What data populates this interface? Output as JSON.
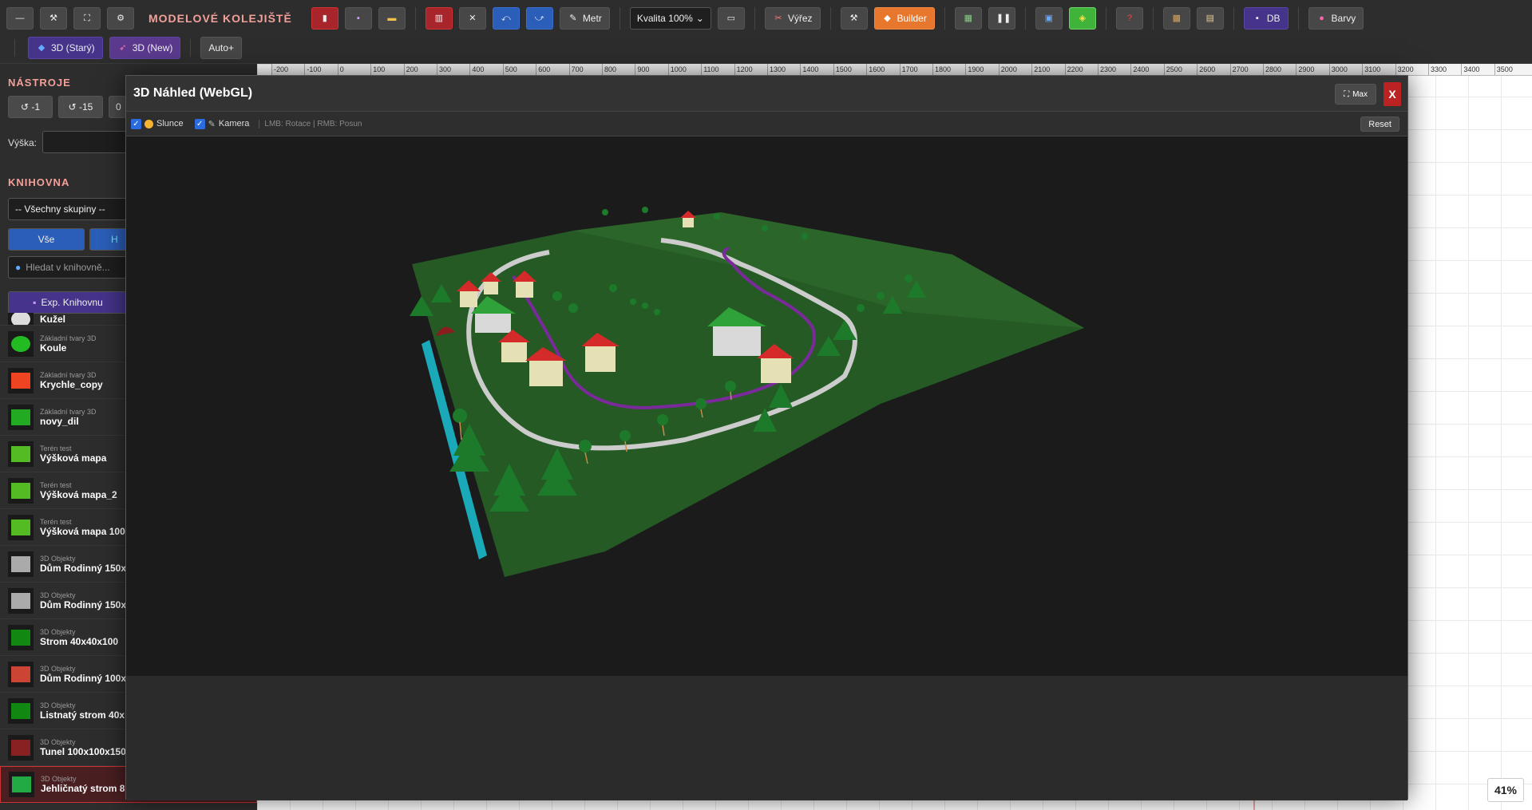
{
  "toolbar": {
    "app_title": "MODELOVÉ KOLEJIŠTĚ",
    "measure_label": "Metr",
    "quality_value": "Kvalita 100%",
    "crop_label": "Výřez",
    "builder_label": "Builder",
    "db_label": "DB",
    "colors_label": "Barvy",
    "view3d_old_label": "3D (Starý)",
    "view3d_new_label": "3D (New)",
    "auto_label": "Auto+"
  },
  "left": {
    "tools_title": "NÁSTROJE",
    "rot_minus1": "↺ -1",
    "rot_minus15": "↺ -15",
    "rot_zero": "0",
    "height_label": "Výška:",
    "library_title": "KNIHOVNA",
    "group_select": "-- Všechny skupiny --",
    "filter_all": "Vše",
    "filter_second": "H",
    "search_placeholder": "Hledat v knihovně...",
    "export_label": "Exp. Knihovnu",
    "items": [
      {
        "cat": "",
        "name": "Kužel",
        "color": "#dddddd"
      },
      {
        "cat": "Základní tvary 3D",
        "name": "Koule",
        "color": "#22bb22"
      },
      {
        "cat": "Základní tvary 3D",
        "name": "Krychle_copy",
        "color": "#ee4422"
      },
      {
        "cat": "Základní tvary 3D",
        "name": "novy_dil",
        "color": "#22aa22"
      },
      {
        "cat": "Terén test",
        "name": "Výšková mapa",
        "color": "#55bb22"
      },
      {
        "cat": "Terén test",
        "name": "Výšková mapa_2",
        "color": "#55bb22"
      },
      {
        "cat": "Terén test",
        "name": "Výšková mapa 100",
        "color": "#55bb22"
      },
      {
        "cat": "3D Objekty",
        "name": "Dům Rodinný 150x",
        "color": "#aaaaaa"
      },
      {
        "cat": "3D Objekty",
        "name": "Dům Rodinný 150x",
        "color": "#aaaaaa"
      },
      {
        "cat": "3D Objekty",
        "name": "Strom 40x40x100",
        "color": "#118811"
      },
      {
        "cat": "3D Objekty",
        "name": "Dům Rodinný 100x",
        "color": "#cc4433"
      },
      {
        "cat": "3D Objekty",
        "name": "Listnatý strom 40x",
        "color": "#118811"
      },
      {
        "cat": "3D Objekty",
        "name": "Tunel 100x100x150",
        "color": "#882222"
      },
      {
        "cat": "3D Objekty",
        "name": "Jehličnatý strom 8",
        "color": "#22aa44"
      }
    ]
  },
  "ruler": [
    "-200",
    "-100",
    "0",
    "100",
    "200",
    "300",
    "400",
    "500",
    "600",
    "700",
    "800",
    "900",
    "1000",
    "1100",
    "1200",
    "1300",
    "1400",
    "1500",
    "1600",
    "1700",
    "1800",
    "1900",
    "2000",
    "2100",
    "2200",
    "2300",
    "2400",
    "2500",
    "2600",
    "2700",
    "2800",
    "2900",
    "3000",
    "3100",
    "3200",
    "3300",
    "3400",
    "3500"
  ],
  "zoom": "41%",
  "modal": {
    "title": "3D Náhled (WebGL)",
    "max_label": "Max",
    "close_label": "X",
    "sun_label": "Slunce",
    "camera_label": "Kamera",
    "hint": "LMB: Rotace | RMB: Posun",
    "reset_label": "Reset"
  }
}
